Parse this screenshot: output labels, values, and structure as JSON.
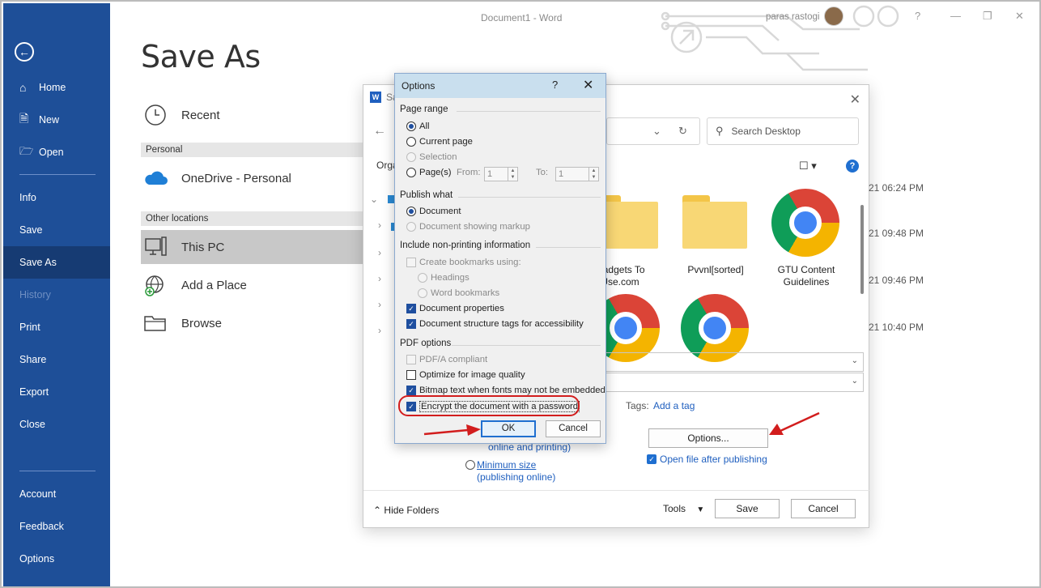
{
  "app": {
    "window_title": "Document1  -  Word",
    "user_name": "paras rastogi",
    "help_icon": "?",
    "accent": "#1e4f98"
  },
  "backstage": {
    "items": [
      {
        "label": "Home",
        "icon": "home-icon"
      },
      {
        "label": "New",
        "icon": "new-document-icon"
      },
      {
        "label": "Open",
        "icon": "open-folder-icon"
      },
      {
        "label": "Info"
      },
      {
        "label": "Save"
      },
      {
        "label": "Save As",
        "active": true
      },
      {
        "label": "History",
        "disabled": true
      },
      {
        "label": "Print"
      },
      {
        "label": "Share"
      },
      {
        "label": "Export"
      },
      {
        "label": "Close"
      },
      {
        "label": "Account"
      },
      {
        "label": "Feedback"
      },
      {
        "label": "Options"
      }
    ]
  },
  "main": {
    "title": "Save As",
    "recent_label": "Recent",
    "personal_header": "Personal",
    "onedrive_label": "OneDrive - Personal",
    "other_header": "Other locations",
    "this_pc_label": "This PC",
    "add_place_label": "Add a Place",
    "browse_label": "Browse"
  },
  "saveas_dialog": {
    "title_fragment": "Sa",
    "search_placeholder": "Search Desktop",
    "organize_fragment": "Orga",
    "files": [
      {
        "name": "Gadgets To Use.com",
        "type": "folder"
      },
      {
        "name": "Pvvnl[sorted]",
        "type": "folder"
      },
      {
        "name": "GTU Content Guidelines",
        "type": "chrome"
      }
    ],
    "dates": [
      "21 06:24 PM",
      "21 09:48 PM",
      "21 09:46 PM",
      "21 10:40 PM"
    ],
    "tags_label": "Tags:",
    "tags_link": "Add a tag",
    "options_button": "Options...",
    "open_after_label": "Open file after publishing",
    "online_printing_text": "online and printing)",
    "minimum_size_label": "Minimum size",
    "minimum_size_sub": "(publishing online)",
    "hide_folders_label": "Hide Folders",
    "tools_label": "Tools",
    "save_button": "Save",
    "cancel_button": "Cancel"
  },
  "options_dialog": {
    "title": "Options",
    "help": "?",
    "page_range_header": "Page range",
    "page_range": {
      "all": "All",
      "current": "Current page",
      "selection": "Selection",
      "pages": "Page(s)",
      "from_label": "From:",
      "from_value": "1",
      "to_label": "To:",
      "to_value": "1"
    },
    "publish_what_header": "Publish what",
    "publish_what": {
      "document": "Document",
      "markup": "Document showing markup"
    },
    "non_printing_header": "Include non-printing information",
    "non_printing": {
      "bookmarks": "Create bookmarks using:",
      "headings": "Headings",
      "word_bookmarks": "Word bookmarks",
      "properties": "Document properties",
      "structure_tags": "Document structure tags for accessibility"
    },
    "pdf_options_header": "PDF options",
    "pdf_options": {
      "pdfa": "PDF/A compliant",
      "optimize": "Optimize for image quality",
      "bitmap": "Bitmap text when fonts may not be embedded",
      "encrypt": "Encrypt the document with a password"
    },
    "ok_button": "OK",
    "cancel_button": "Cancel"
  },
  "colors": {
    "highlight_red": "#d21d1d",
    "arrow_red": "#d21d1d",
    "checkbox_blue": "#1f4f9f"
  }
}
